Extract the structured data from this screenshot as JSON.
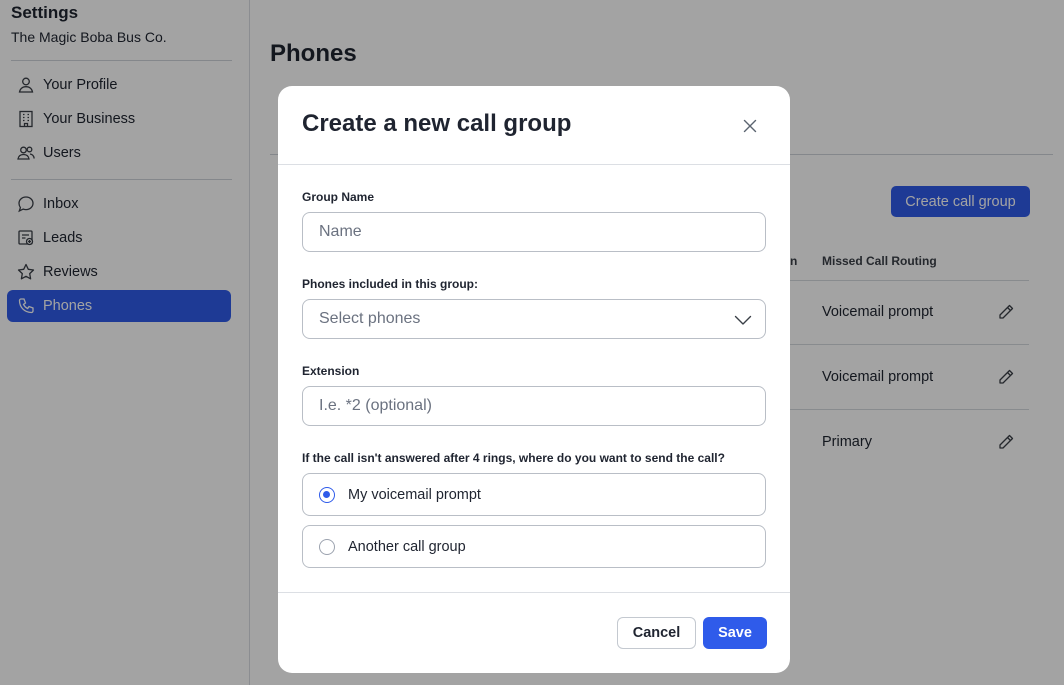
{
  "sidebar": {
    "title": "Settings",
    "subtitle": "The Magic Boba Bus Co.",
    "items": [
      {
        "label": "Your Profile",
        "icon": "user-icon"
      },
      {
        "label": "Your Business",
        "icon": "building-icon"
      },
      {
        "label": "Users",
        "icon": "users-icon"
      },
      {
        "label": "Inbox",
        "icon": "chat-bubble-icon"
      },
      {
        "label": "Leads",
        "icon": "leads-icon"
      },
      {
        "label": "Reviews",
        "icon": "star-icon"
      },
      {
        "label": "Phones",
        "icon": "phone-icon",
        "active": true
      }
    ]
  },
  "main": {
    "page_title": "Phones",
    "create_button": "Create call group",
    "table": {
      "partial_header": "n",
      "header": "Missed Call Routing",
      "rows": [
        {
          "routing": "Voicemail prompt"
        },
        {
          "routing": "Voicemail prompt"
        },
        {
          "routing": "Primary"
        }
      ]
    }
  },
  "modal": {
    "title": "Create a new call group",
    "group_name": {
      "label": "Group Name",
      "placeholder": "Name",
      "value": ""
    },
    "phones": {
      "label": "Phones included in this group:",
      "placeholder": "Select phones"
    },
    "extension": {
      "label": "Extension",
      "placeholder": "I.e. *2 (optional)",
      "value": ""
    },
    "routing": {
      "question": "If the call isn't answered after 4 rings, where do you want to send the call?",
      "options": [
        {
          "label": "My voicemail prompt",
          "checked": true
        },
        {
          "label": "Another call group",
          "checked": false
        }
      ]
    },
    "cancel_label": "Cancel",
    "save_label": "Save"
  },
  "colors": {
    "accent": "#2f5bea",
    "overlay": "rgba(0,0,0,0.36)",
    "text": "#1f2430",
    "border": "#b9bec6"
  }
}
